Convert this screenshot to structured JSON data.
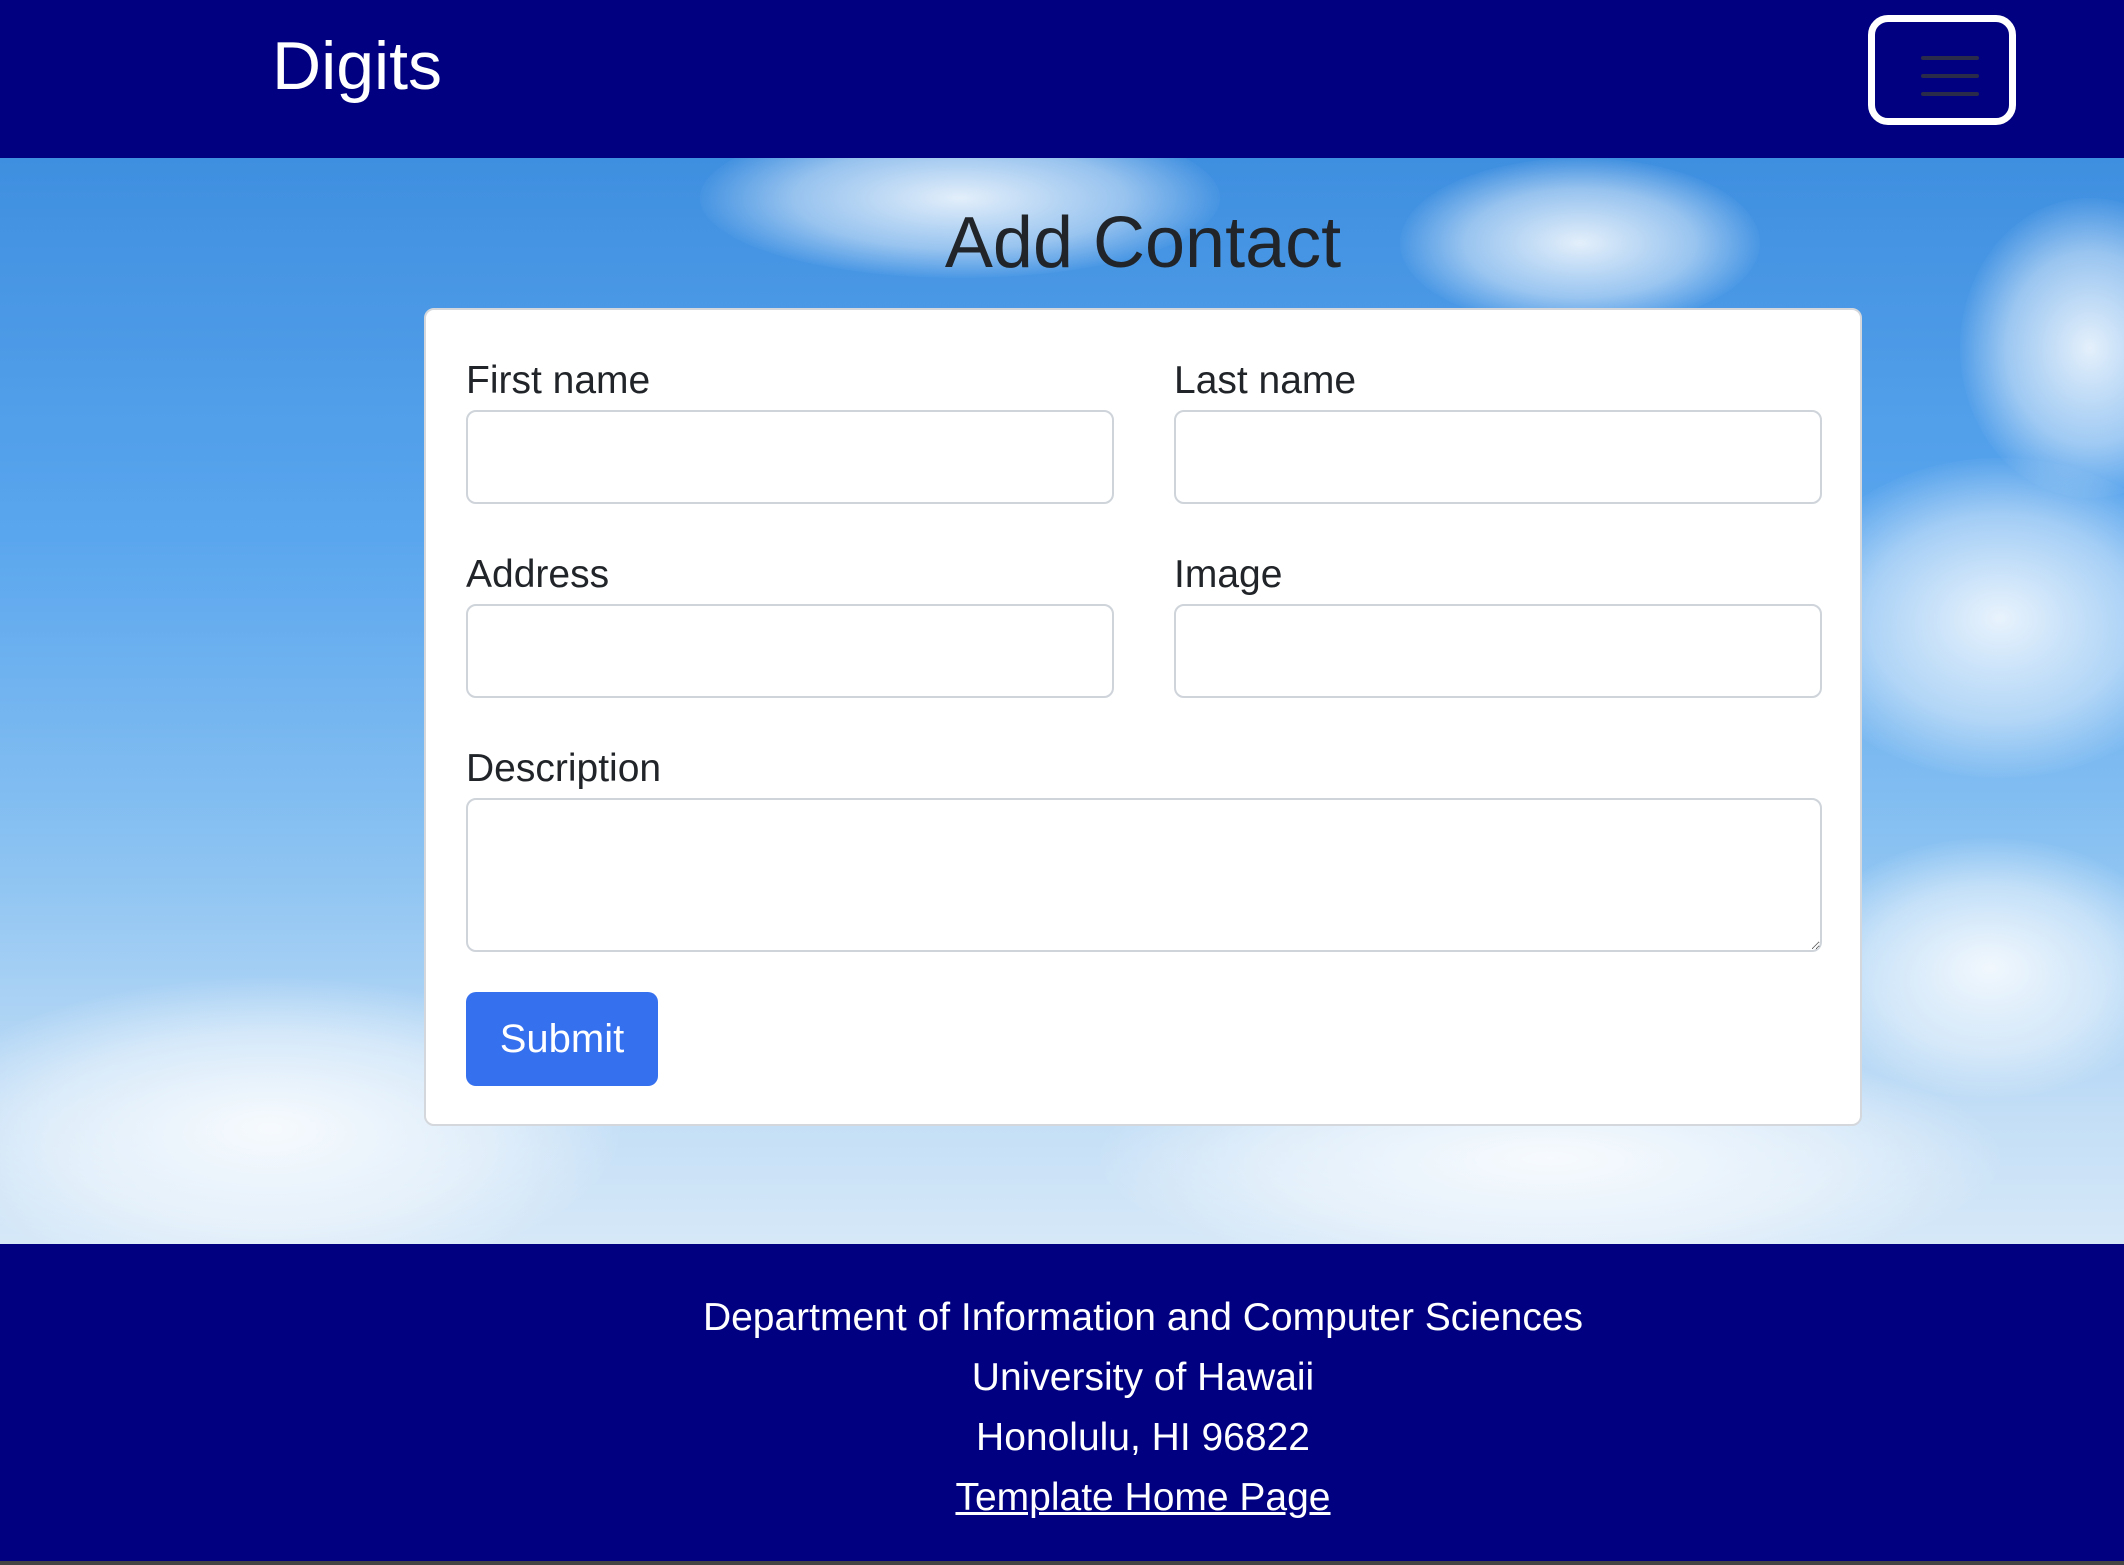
{
  "navbar": {
    "brand": "Digits",
    "toggler_icon": "hamburger-menu-icon",
    "background_color": "#000080"
  },
  "page": {
    "title": "Add Contact"
  },
  "form": {
    "first_name": {
      "label": "First name",
      "value": ""
    },
    "last_name": {
      "label": "Last name",
      "value": ""
    },
    "address": {
      "label": "Address",
      "value": ""
    },
    "image": {
      "label": "Image",
      "value": ""
    },
    "description": {
      "label": "Description",
      "value": ""
    },
    "submit_label": "Submit",
    "submit_color": "#3570ee"
  },
  "footer": {
    "line1": "Department of Information and Computer Sciences",
    "line2": "University of Hawaii",
    "line3": "Honolulu, HI 96822",
    "link_text": "Template Home Page",
    "background_color": "#000080"
  }
}
